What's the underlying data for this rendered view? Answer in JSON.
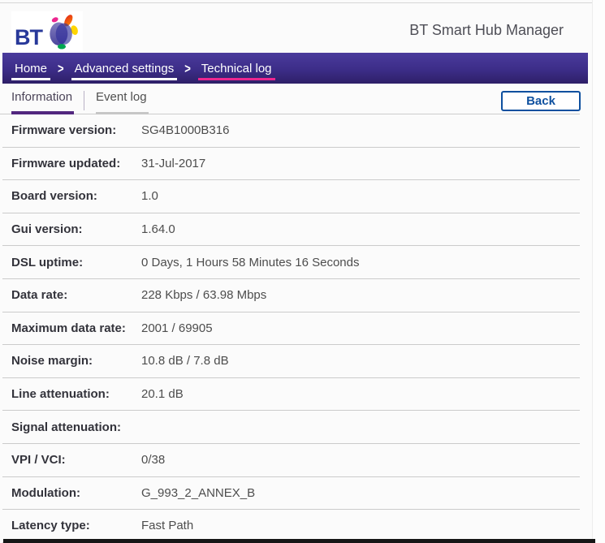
{
  "header": {
    "logo_text": "BT",
    "title": "BT Smart Hub Manager"
  },
  "breadcrumb": {
    "separator": ">",
    "items": [
      {
        "label": "Home"
      },
      {
        "label": "Advanced settings"
      },
      {
        "label": "Technical log"
      }
    ]
  },
  "tabs": {
    "items": [
      {
        "label": "Information",
        "active": true
      },
      {
        "label": "Event log",
        "active": false
      }
    ]
  },
  "toolbar": {
    "back_label": "Back"
  },
  "info_table": {
    "rows": [
      {
        "label": "Firmware version:",
        "value": "SG4B1000B316"
      },
      {
        "label": "Firmware updated:",
        "value": "31-Jul-2017"
      },
      {
        "label": "Board version:",
        "value": "1.0"
      },
      {
        "label": "Gui version:",
        "value": "1.64.0"
      },
      {
        "label": "DSL uptime:",
        "value": "0 Days, 1 Hours 58 Minutes 16 Seconds"
      },
      {
        "label": "Data rate:",
        "value": "228 Kbps / 63.98 Mbps"
      },
      {
        "label": "Maximum data rate:",
        "value": "2001 / 69905"
      },
      {
        "label": "Noise margin:",
        "value": "10.8 dB / 7.8 dB"
      },
      {
        "label": "Line attenuation:",
        "value": "20.1 dB"
      },
      {
        "label": "Signal attenuation:",
        "value": ""
      },
      {
        "label": "VPI / VCI:",
        "value": "0/38"
      },
      {
        "label": "Modulation:",
        "value": "G_993_2_ANNEX_B"
      },
      {
        "label": "Latency type:",
        "value": "Fast Path"
      }
    ]
  },
  "colors": {
    "nav_purple_top": "#4a3b9d",
    "nav_purple_bottom": "#2e1f67",
    "accent_pink": "#ec268f",
    "tab_active_underline": "#52277f",
    "back_button_blue": "#0e509f",
    "bt_logo_blue": "#28399a"
  }
}
